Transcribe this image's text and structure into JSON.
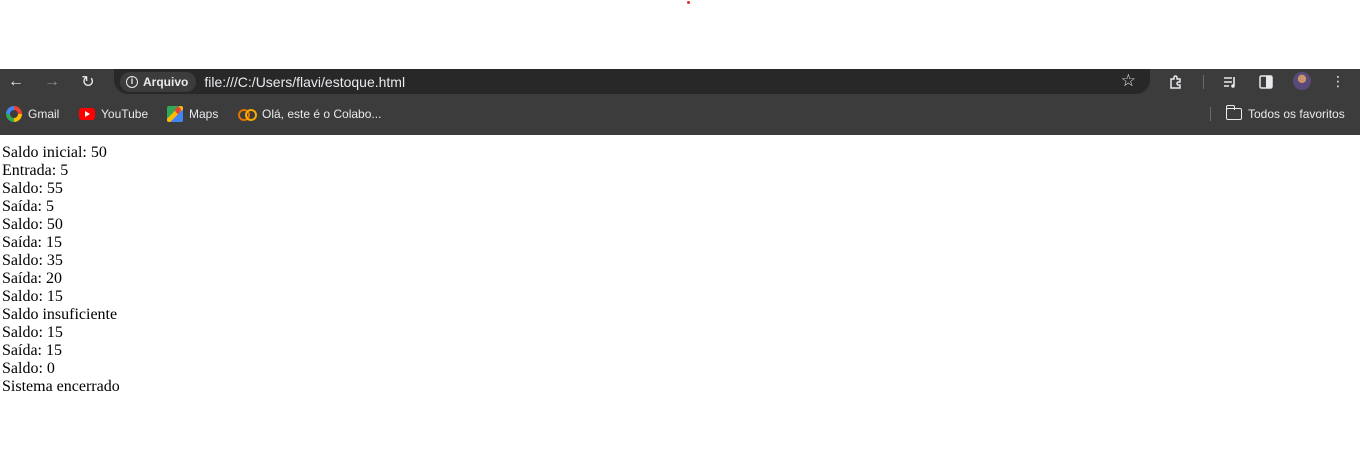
{
  "address_bar": {
    "security_chip_label": "Arquivo",
    "url": "file:///C:/Users/flavi/estoque.html"
  },
  "bookmarks": {
    "items": [
      {
        "label": "Gmail",
        "icon": "google-icon"
      },
      {
        "label": "YouTube",
        "icon": "youtube-icon"
      },
      {
        "label": "Maps",
        "icon": "maps-icon"
      },
      {
        "label": "Olá, este é o Colabo...",
        "icon": "colab-icon"
      }
    ],
    "all_bookmarks_label": "Todos os favoritos"
  },
  "output_lines": [
    "Saldo inicial: 50",
    "Entrada: 5",
    "Saldo: 55",
    "Saída: 5",
    "Saldo: 50",
    "Saída: 15",
    "Saldo: 35",
    "Saída: 20",
    "Saldo: 15",
    "Saldo insuficiente",
    "Saldo: 15",
    "Saída: 15",
    "Saldo: 0",
    "Sistema encerrado"
  ],
  "colors": {
    "toolbar_bg": "#3c3c3c",
    "omnibox_bg": "#282828",
    "text_light": "#e8eaed"
  }
}
